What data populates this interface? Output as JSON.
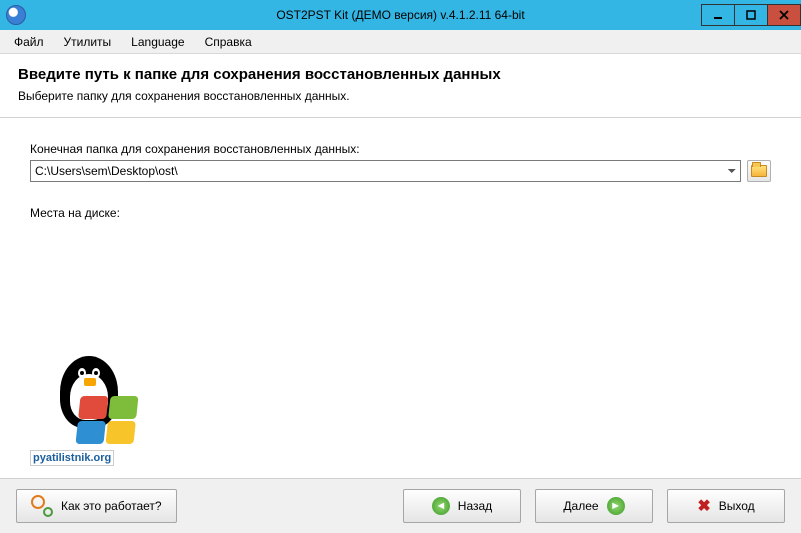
{
  "window": {
    "title": "OST2PST Kit (ДЕМО версия) v.4.1.2.11 64-bit"
  },
  "menu": {
    "file": "Файл",
    "utilities": "Утилиты",
    "language": "Language",
    "help": "Справка"
  },
  "header": {
    "title": "Введите путь к папке для сохранения восстановленных данных",
    "subtitle": "Выберите папку для сохранения восстановленных данных."
  },
  "fields": {
    "destination_label": "Конечная папка для сохранения восстановленных данных:",
    "destination_value": "C:\\Users\\sem\\Desktop\\ost\\",
    "disk_space_label": "Места на диске:"
  },
  "logo": {
    "text": "pyatilistnik.org"
  },
  "footer": {
    "how": "Как это работает?",
    "back": "Назад",
    "next": "Далее",
    "exit": "Выход"
  }
}
